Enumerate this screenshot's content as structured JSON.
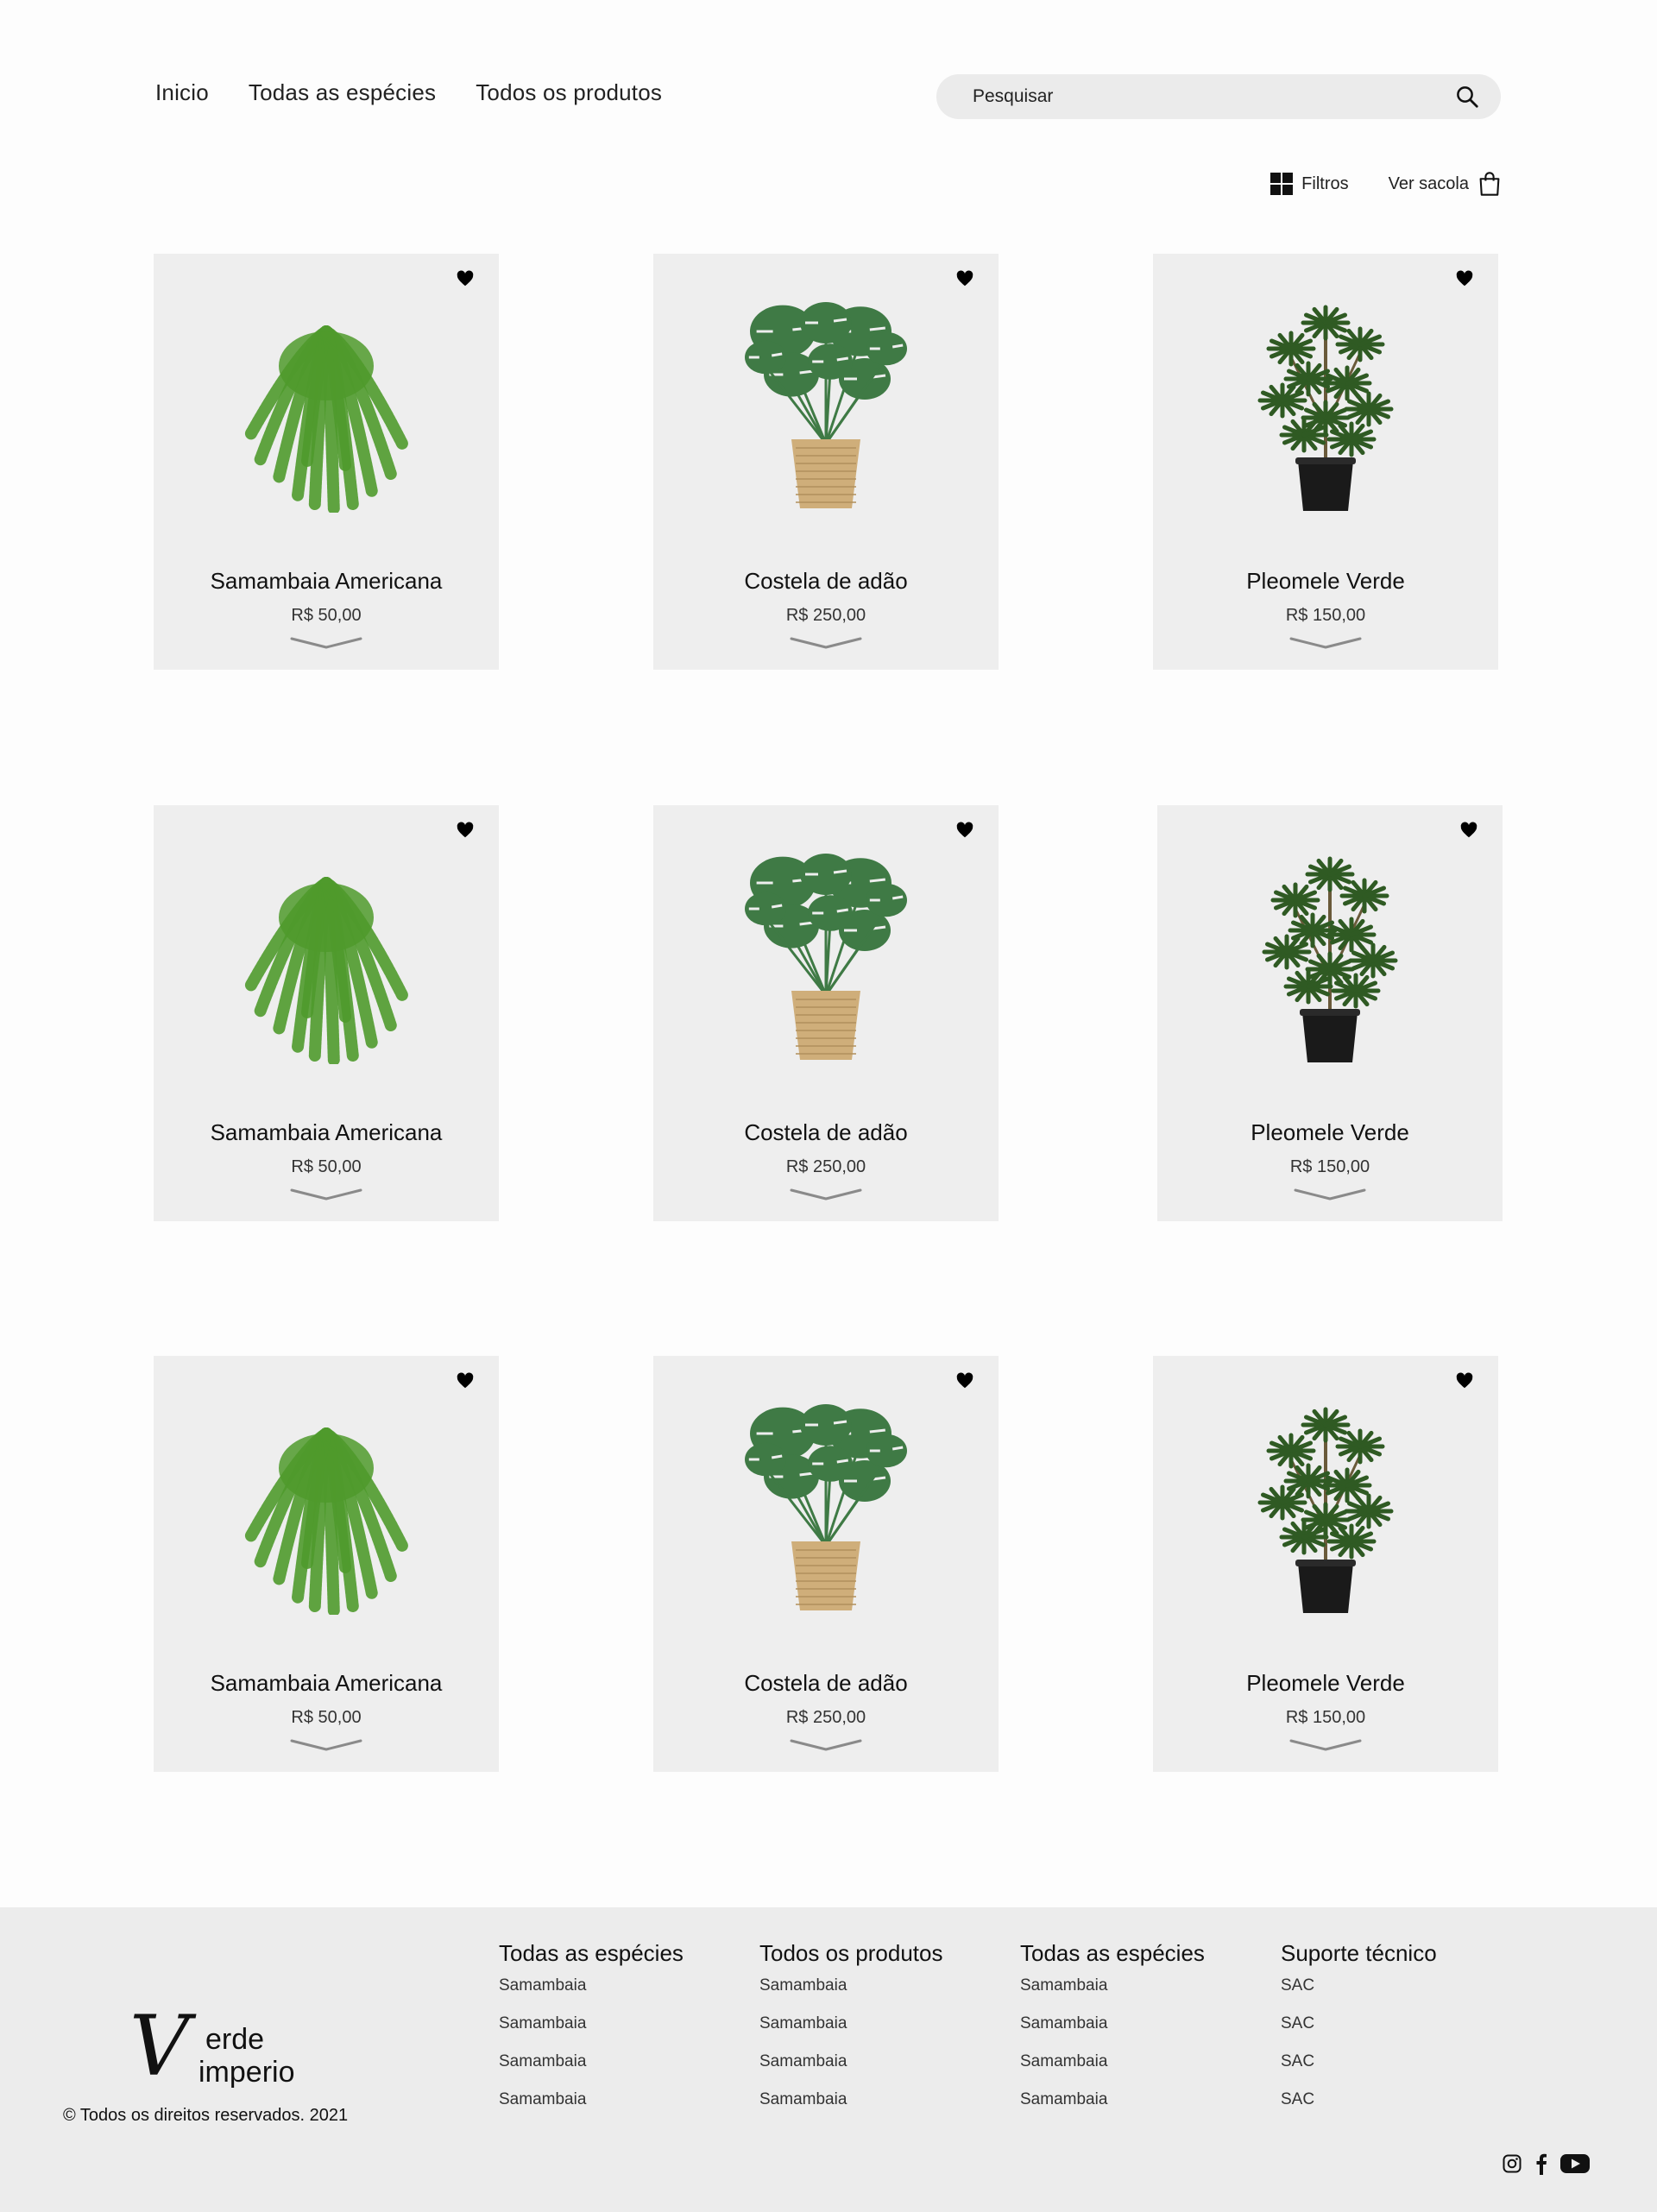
{
  "nav": {
    "items": [
      "Inicio",
      "Todas as espécies",
      "Todos os produtos"
    ]
  },
  "search": {
    "placeholder": "Pesquisar"
  },
  "toolbar": {
    "filters": "Filtros",
    "bag": "Ver sacola"
  },
  "products": [
    {
      "name": "Samambaia Americana",
      "price": "R$ 50,00",
      "plant": "fern"
    },
    {
      "name": "Costela de adão",
      "price": "R$ 250,00",
      "plant": "monstera"
    },
    {
      "name": "Pleomele Verde",
      "price": "R$ 150,00",
      "plant": "pleomele"
    },
    {
      "name": "Samambaia Americana",
      "price": "R$ 50,00",
      "plant": "fern"
    },
    {
      "name": "Costela de adão",
      "price": "R$ 250,00",
      "plant": "monstera"
    },
    {
      "name": "Pleomele Verde",
      "price": "R$ 150,00",
      "plant": "pleomele"
    },
    {
      "name": "Samambaia Americana",
      "price": "R$ 50,00",
      "plant": "fern"
    },
    {
      "name": "Costela de adão",
      "price": "R$ 250,00",
      "plant": "monstera"
    },
    {
      "name": "Pleomele Verde",
      "price": "R$ 150,00",
      "plant": "pleomele"
    }
  ],
  "footer": {
    "logo": {
      "line1": "erde",
      "line2": "imperio",
      "initial": "V"
    },
    "copyright": "© Todos os direitos reservados. 2021",
    "columns": [
      {
        "title": "Todas as espécies",
        "links": [
          "Samambaia",
          "Samambaia",
          "Samambaia",
          "Samambaia"
        ]
      },
      {
        "title": "Todos os produtos",
        "links": [
          "Samambaia",
          "Samambaia",
          "Samambaia",
          "Samambaia"
        ]
      },
      {
        "title": "Todas as espécies",
        "links": [
          "Samambaia",
          "Samambaia",
          "Samambaia",
          "Samambaia"
        ]
      },
      {
        "title": "Suporte técnico",
        "links": [
          "SAC",
          "SAC",
          "SAC",
          "SAC"
        ]
      }
    ],
    "social": [
      "instagram-icon",
      "facebook-icon",
      "youtube-icon"
    ]
  },
  "colors": {
    "card_bg": "#eeeeee",
    "footer_bg": "#ececec",
    "fern": "#4f9a2c",
    "monstera": "#3f7a45",
    "pleomele": "#2f5a23",
    "basket": "#cfae7a",
    "pot": "#1a1a1a"
  }
}
